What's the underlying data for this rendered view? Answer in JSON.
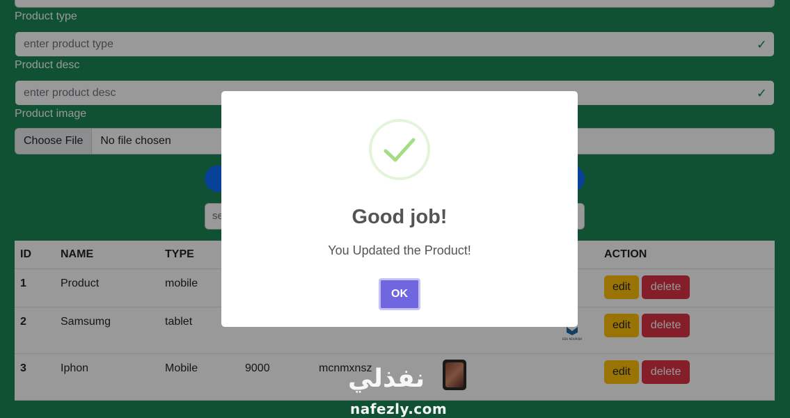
{
  "form": {
    "type_label": "Product type",
    "type_placeholder": "enter product type",
    "desc_label": "Product desc",
    "desc_placeholder": "enter product desc",
    "image_label": "Product image",
    "file_button": "Choose File",
    "file_status": "No file chosen",
    "search_placeholder": "se"
  },
  "table": {
    "headers": [
      "ID",
      "NAME",
      "TYPE",
      "",
      "",
      "",
      "ACTION"
    ],
    "rows": [
      {
        "id": "1",
        "name": "Product",
        "type": "mobile",
        "price": "",
        "desc": ""
      },
      {
        "id": "2",
        "name": "Samsumg",
        "type": "tablet",
        "price": "",
        "desc": ""
      },
      {
        "id": "3",
        "name": "Iphon",
        "type": "Mobile",
        "price": "9000",
        "desc": "mcnmxnsz"
      }
    ],
    "edit_label": "edit",
    "delete_label": "delete",
    "logo_caption": "EDU NOURISH"
  },
  "modal": {
    "title": "Good job!",
    "text": "You Updated the Product!",
    "ok_label": "OK"
  },
  "watermark": {
    "arabic": "نفذلي",
    "latin": "nafezly.com"
  },
  "colors": {
    "background": "#198754",
    "primary": "#0d6efd",
    "edit": "#ffc107",
    "delete": "#dc3545",
    "ok": "#7066e0",
    "success_check": "#a5dc86"
  }
}
